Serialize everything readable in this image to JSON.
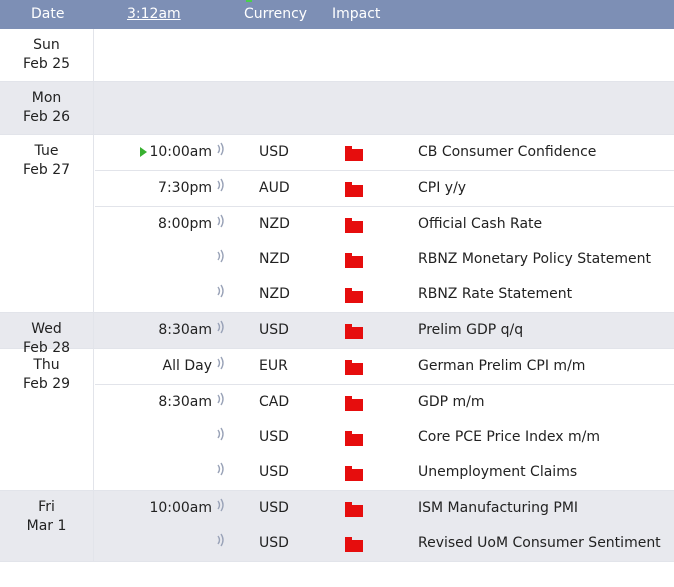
{
  "header": {
    "date_label": "Date",
    "time_label": "3:12am",
    "currency_label": "Currency",
    "impact_label": "Impact"
  },
  "colors": {
    "header_bg": "#7d8fb5",
    "shade_bg": "#e8e9ee",
    "impact_high": "#e60d0d",
    "next_arrow": "#38b030"
  },
  "icons": {
    "sound": "sound-icon",
    "impact": "folder-icon",
    "next": "play-arrow-icon"
  },
  "days": [
    {
      "weekday": "Sun",
      "date": "Feb 25",
      "events": []
    },
    {
      "weekday": "Mon",
      "date": "Feb 26",
      "events": []
    },
    {
      "weekday": "Tue",
      "date": "Feb 27",
      "events": [
        {
          "time": "10:00am",
          "currency": "USD",
          "title": "CB Consumer Confidence",
          "next": true
        },
        {
          "time": "7:30pm",
          "currency": "AUD",
          "title": "CPI y/y"
        },
        {
          "time": "8:00pm",
          "currency": "NZD",
          "title": "Official Cash Rate"
        },
        {
          "time": "",
          "currency": "NZD",
          "title": "RBNZ Monetary Policy Statement"
        },
        {
          "time": "",
          "currency": "NZD",
          "title": "RBNZ Rate Statement"
        }
      ]
    },
    {
      "weekday": "Wed",
      "date": "Feb 28",
      "events": [
        {
          "time": "8:30am",
          "currency": "USD",
          "title": "Prelim GDP q/q"
        }
      ]
    },
    {
      "weekday": "Thu",
      "date": "Feb 29",
      "events": [
        {
          "time": "All Day",
          "currency": "EUR",
          "title": "German Prelim CPI m/m"
        },
        {
          "time": "8:30am",
          "currency": "CAD",
          "title": "GDP m/m"
        },
        {
          "time": "",
          "currency": "USD",
          "title": "Core PCE Price Index m/m"
        },
        {
          "time": "",
          "currency": "USD",
          "title": "Unemployment Claims"
        }
      ]
    },
    {
      "weekday": "Fri",
      "date": "Mar 1",
      "events": [
        {
          "time": "10:00am",
          "currency": "USD",
          "title": "ISM Manufacturing PMI"
        },
        {
          "time": "",
          "currency": "USD",
          "title": "Revised UoM Consumer Sentiment"
        }
      ]
    }
  ]
}
